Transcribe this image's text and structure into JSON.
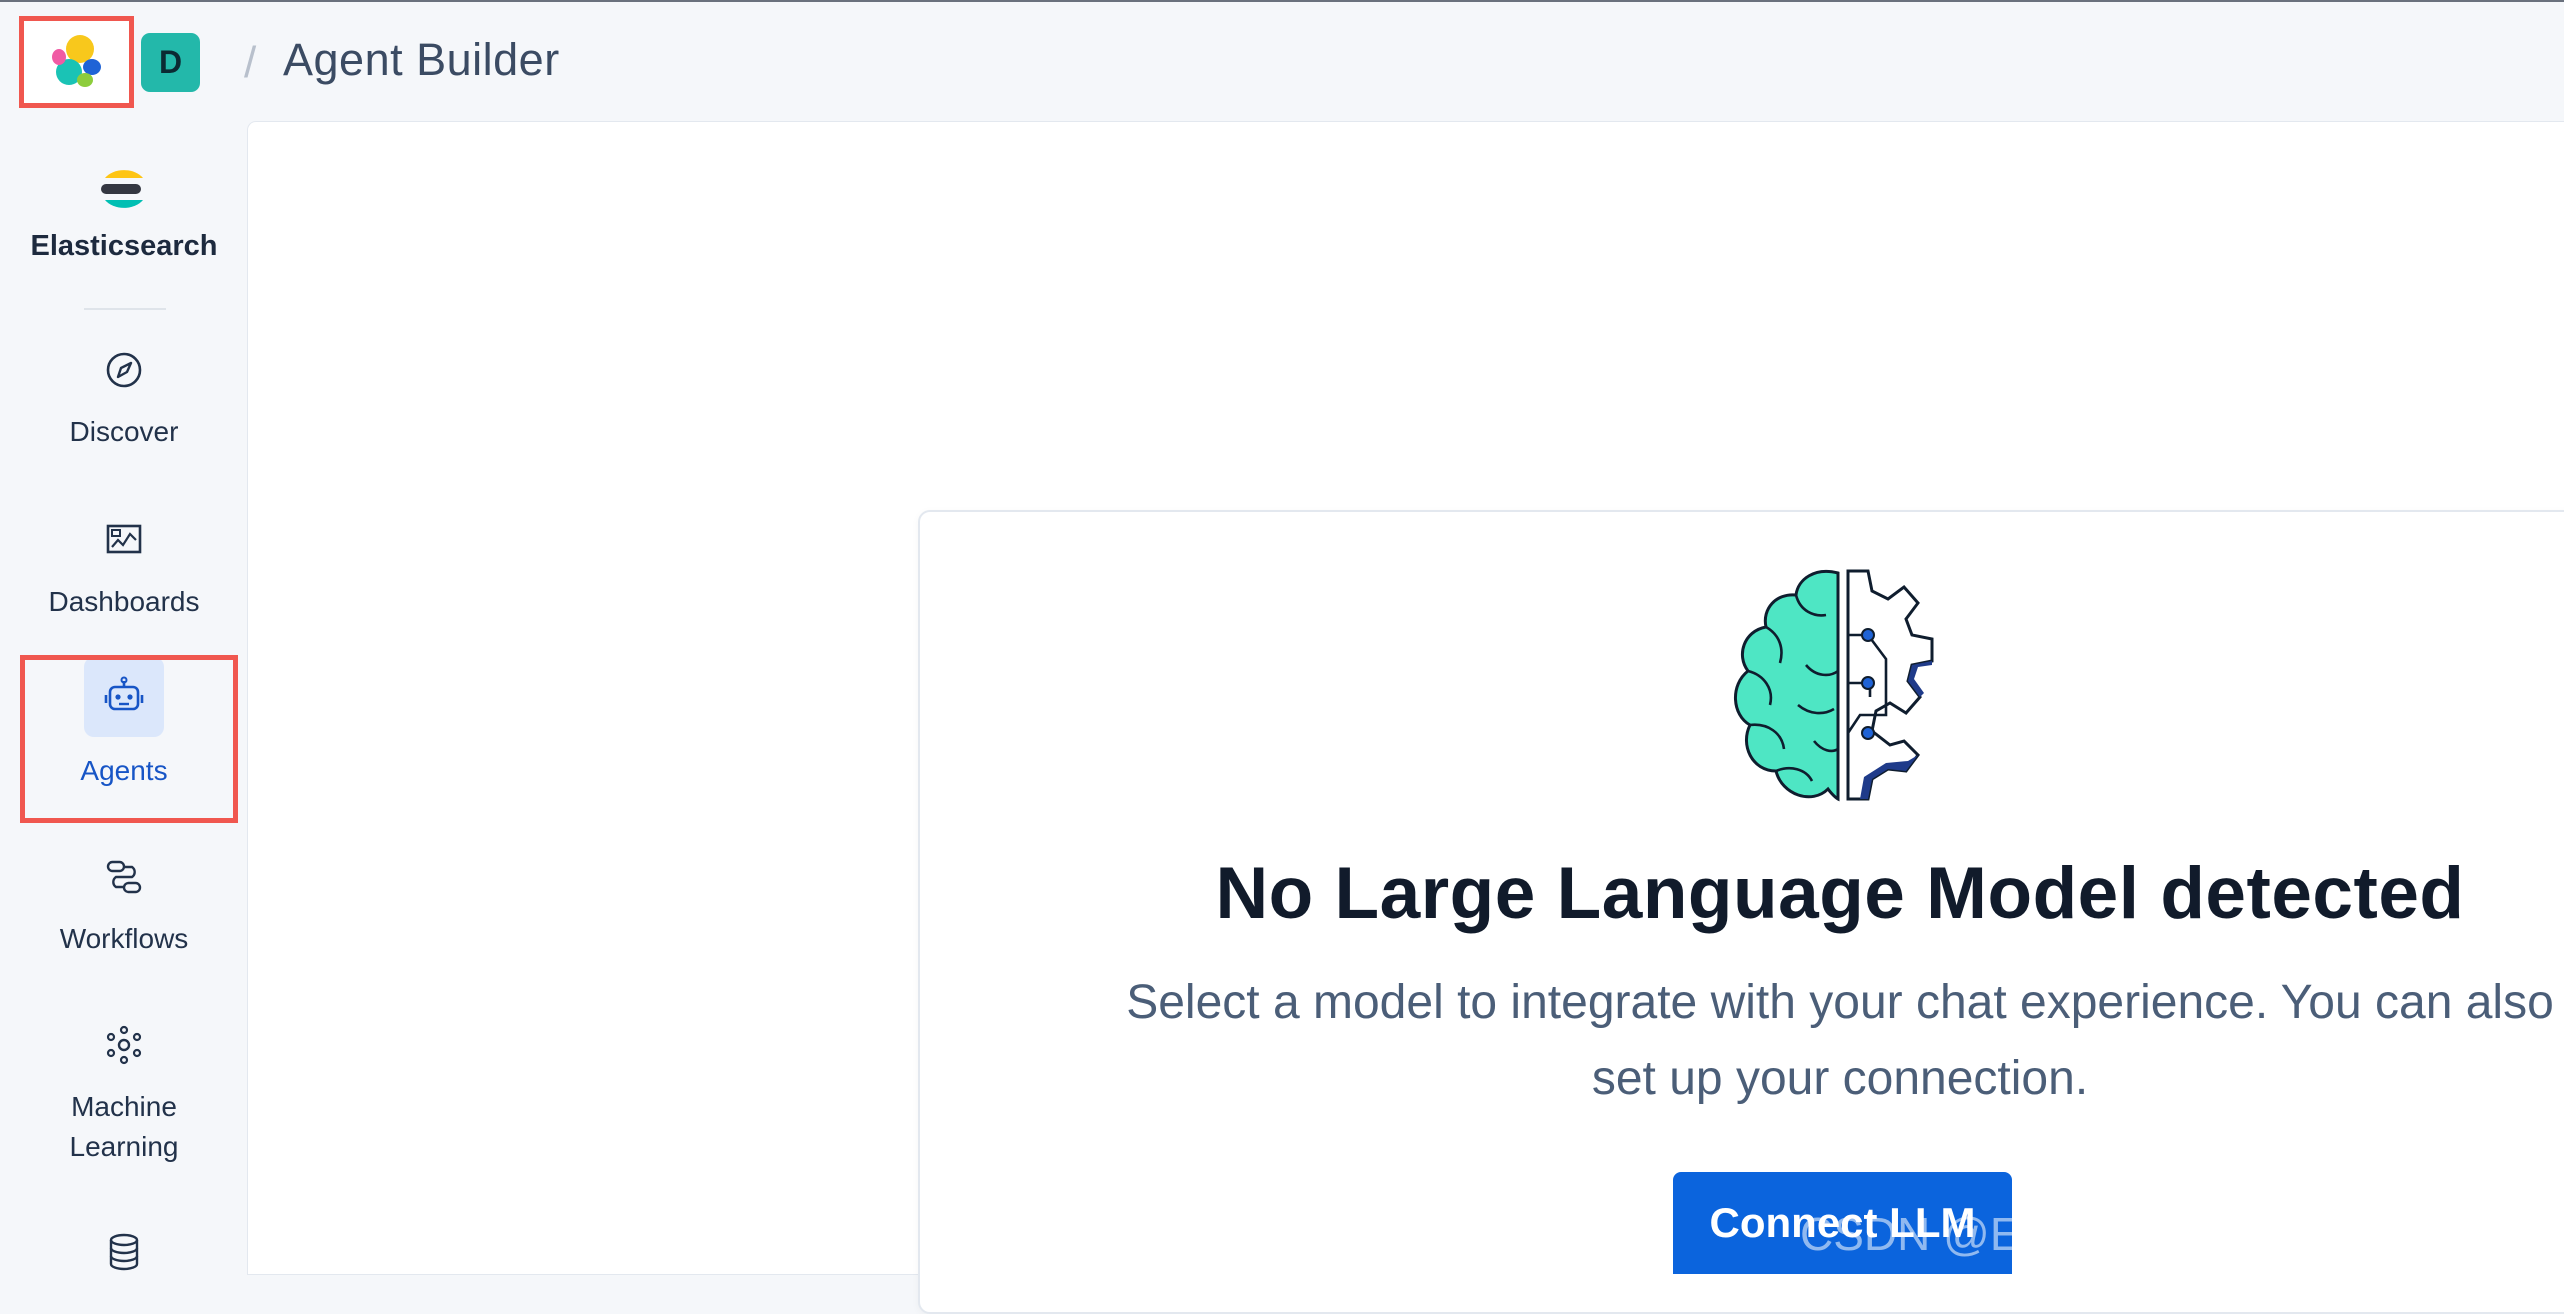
{
  "header": {
    "space_initial": "D",
    "breadcrumb_separator": "/",
    "page_title": "Agent Builder"
  },
  "sidebar": {
    "items": [
      {
        "label": "Elasticsearch",
        "icon": "elasticsearch-logo-icon"
      },
      {
        "label": "Discover",
        "icon": "compass-icon"
      },
      {
        "label": "Dashboards",
        "icon": "dashboard-icon"
      },
      {
        "label": "Agents",
        "icon": "robot-icon",
        "active": true
      },
      {
        "label": "Workflows",
        "icon": "workflow-icon"
      },
      {
        "label": "Machine Learning",
        "icon": "machine-learning-icon"
      },
      {
        "label": "",
        "icon": "database-icon"
      }
    ]
  },
  "empty_state": {
    "title": "No Large Language Model detected",
    "description": "Select a model to integrate with your chat experience. You can also set up your connection.",
    "button_label": "Connect LLM"
  },
  "watermark": "CSDN @Elastic 中国社区官方博客",
  "colors": {
    "accent": "#0b64dd",
    "highlight_border": "#f0574f",
    "avatar": "#23b8aa",
    "brain": "#4ee6c4"
  }
}
